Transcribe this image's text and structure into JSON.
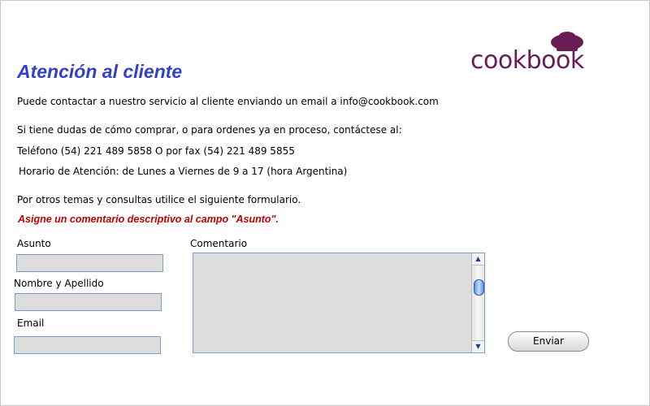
{
  "brand": {
    "logo_text": "cookbook",
    "color": "#6a1d52"
  },
  "title": "Atención al cliente",
  "paragraphs": {
    "intro": "Puede contactar a nuestro servicio al cliente enviando un email a info@cookbook.com",
    "doubts": "Si tiene dudas de cómo comprar, o para ordenes ya en proceso, contáctese al:",
    "phone": "Teléfono (54) 221 489 5858 O por fax (54) 221 489 5855",
    "hours": "Horario de Atención: de Lunes a Viernes de 9 a 17 (hora Argentina)",
    "other": "Por otros temas y consultas utilice el siguiente formulario."
  },
  "warning": "Asigne un comentario descriptivo al campo \"Asunto\".",
  "form": {
    "asunto_label": "Asunto",
    "asunto_value": "",
    "nombre_label": "Nombre y Apellido",
    "nombre_value": "",
    "email_label": "Email",
    "email_value": "",
    "comentario_label": "Comentario",
    "comentario_value": "",
    "submit_label": "Enviar"
  },
  "icons": {
    "logo": "chef-hat-icon",
    "scroll_up": "triangle-up-icon",
    "scroll_down": "triangle-down-icon"
  },
  "colors": {
    "title": "#3340cc",
    "warning": "#c00000",
    "field_bg": "#dddddd",
    "field_border": "#7f9dcc"
  }
}
